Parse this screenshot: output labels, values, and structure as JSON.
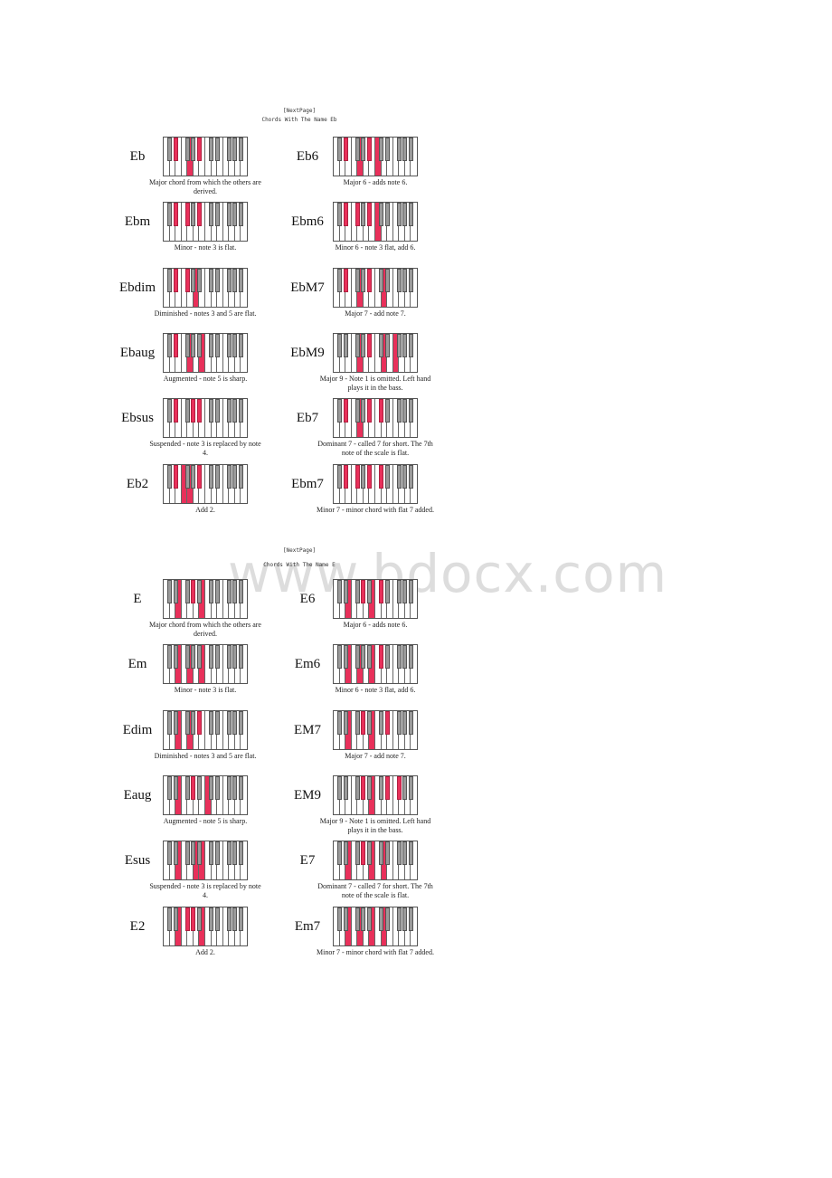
{
  "watermark": "www.bdocx.com",
  "keyboard": {
    "white_keys": 14,
    "black_key_after_white": [
      0,
      1,
      3,
      4,
      5,
      7,
      8,
      10,
      11,
      12
    ],
    "highlight_color": "#e8305a",
    "black_key_color": "#9a9a9a"
  },
  "sections": [
    {
      "next_page": "[NextPage]",
      "title": "Chords With The Name Eb",
      "chords": [
        {
          "name": "Eb",
          "desc": "Major chord from which the others are derived.",
          "white": [
            4
          ],
          "black": [
            1,
            4
          ]
        },
        {
          "name": "Eb6",
          "desc": "Major 6 - adds note 6.",
          "white": [
            4,
            7
          ],
          "black": [
            1,
            4
          ]
        },
        {
          "name": "Ebm",
          "desc": "Minor - note 3 is flat.",
          "white": [],
          "black": [
            1,
            2,
            4
          ]
        },
        {
          "name": "Ebm6",
          "desc": "Minor 6 - note 3 flat, add 6.",
          "white": [
            7
          ],
          "black": [
            1,
            2,
            4
          ]
        },
        {
          "name": "Ebdim",
          "desc": "Diminished - notes 3 and 5 are flat.",
          "white": [
            5
          ],
          "black": [
            1,
            2
          ]
        },
        {
          "name": "EbM7",
          "desc": "Major 7 - add note 7.",
          "white": [
            4,
            8
          ],
          "black": [
            1,
            4
          ]
        },
        {
          "name": "Ebaug",
          "desc": "Augmented - note 5 is sharp.",
          "white": [
            4,
            6
          ],
          "black": [
            1
          ]
        },
        {
          "name": "EbM9",
          "desc": "Major 9 - Note 1 is omitted. Left hand plays it in the bass.",
          "white": [
            4,
            8,
            10
          ],
          "black": [
            4
          ]
        },
        {
          "name": "Ebsus",
          "desc": "Suspended - note 3 is replaced by note 4.",
          "white": [],
          "black": [
            1,
            3,
            4
          ]
        },
        {
          "name": "Eb7",
          "desc": "Dominant 7 - called 7 for short. The 7th note of the scale is flat.",
          "white": [
            4
          ],
          "black": [
            1,
            4,
            5
          ]
        },
        {
          "name": "Eb2",
          "desc": "Add 2.",
          "white": [
            3,
            4
          ],
          "black": [
            1,
            4
          ]
        },
        {
          "name": "Ebm7",
          "desc": "Minor 7 - minor chord with flat 7 added.",
          "white": [],
          "black": [
            1,
            2,
            4,
            5
          ]
        }
      ]
    },
    {
      "next_page": "[NextPage]",
      "title": "Chords With The Name E",
      "chords": [
        {
          "name": "E",
          "desc": "Major chord from which the others are derived.",
          "white": [
            2,
            6
          ],
          "black": [
            3
          ]
        },
        {
          "name": "E6",
          "desc": "Major 6 - adds note 6.",
          "white": [
            2,
            6
          ],
          "black": [
            3,
            5
          ]
        },
        {
          "name": "Em",
          "desc": "Minor - note 3 is flat.",
          "white": [
            2,
            4,
            6
          ],
          "black": []
        },
        {
          "name": "Em6",
          "desc": "Minor 6 - note 3 flat, add 6.",
          "white": [
            2,
            4,
            6
          ],
          "black": [
            5
          ]
        },
        {
          "name": "Edim",
          "desc": "Diminished - notes 3 and 5 are flat.",
          "white": [
            2,
            4
          ],
          "black": [
            4
          ]
        },
        {
          "name": "EM7",
          "desc": "Major 7 - add note 7.",
          "white": [
            2,
            6
          ],
          "black": [
            3,
            6
          ]
        },
        {
          "name": "Eaug",
          "desc": "Augmented - note 5 is sharp.",
          "white": [
            2,
            7
          ],
          "black": [
            3
          ]
        },
        {
          "name": "EM9",
          "desc": "Major 9 - Note 1 is omitted. Left hand plays it in the bass.",
          "white": [
            6
          ],
          "black": [
            3,
            6,
            7
          ]
        },
        {
          "name": "Esus",
          "desc": "Suspended - note 3 is replaced by note 4.",
          "white": [
            2,
            5,
            6
          ],
          "black": []
        },
        {
          "name": "E7",
          "desc": "Dominant 7 - called 7 for short. The 7th note of the scale is flat.",
          "white": [
            2,
            6,
            8
          ],
          "black": [
            3
          ]
        },
        {
          "name": "E2",
          "desc": "Add 2.",
          "white": [
            2,
            6
          ],
          "black": [
            2,
            3
          ]
        },
        {
          "name": "Em7",
          "desc": "Minor 7 - minor chord with flat 7 added.",
          "white": [
            2,
            4,
            6,
            8
          ],
          "black": []
        }
      ]
    }
  ]
}
